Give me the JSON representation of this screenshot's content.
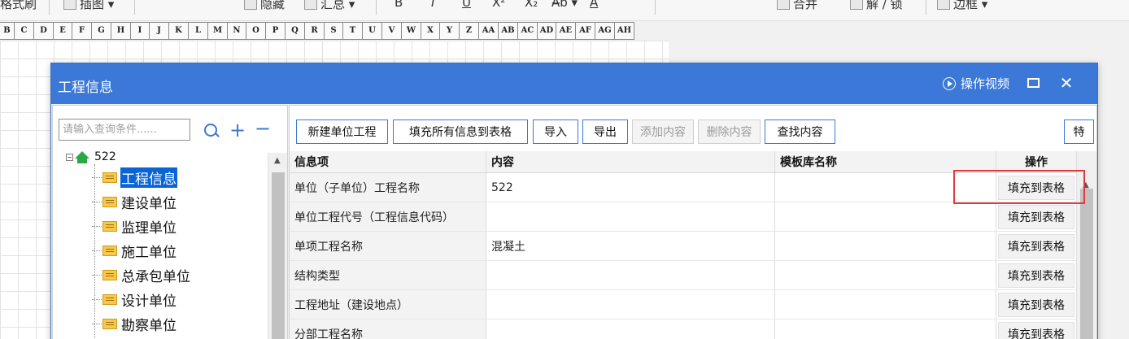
{
  "ribbon": {
    "items": [
      {
        "label": "格式刷",
        "icon": "format-painter-icon"
      },
      {
        "label": "插图 ▾",
        "icon": "picture-icon"
      },
      {
        "label": "隐藏",
        "icon": "hide-icon"
      },
      {
        "label": "汇总 ▾",
        "icon": "sum-icon"
      },
      {
        "label": "B",
        "icon": "bold-icon"
      },
      {
        "label": "I",
        "icon": "italic-icon"
      },
      {
        "label": "U",
        "icon": "underline-icon"
      },
      {
        "label": "X²",
        "icon": "superscript-icon"
      },
      {
        "label": "X₂",
        "icon": "subscript-icon"
      },
      {
        "label": "A̶b ▾",
        "icon": "strikethrough-icon"
      },
      {
        "label": "A",
        "icon": "font-color-icon"
      },
      {
        "label": "合并",
        "icon": "merge-icon"
      },
      {
        "label": "解 / 锁",
        "icon": "lock-icon"
      },
      {
        "label": "边框 ▾",
        "icon": "border-icon"
      }
    ]
  },
  "columns": [
    "B",
    "C",
    "D",
    "E",
    "F",
    "G",
    "H",
    "I",
    "J",
    "K",
    "L",
    "M",
    "N",
    "O",
    "P",
    "Q",
    "R",
    "S",
    "T",
    "U",
    "V",
    "W",
    "X",
    "Y",
    "Z",
    "AA",
    "AB",
    "AC",
    "AD",
    "AE",
    "AF",
    "AG",
    "AH"
  ],
  "dialog": {
    "title": "工程信息",
    "video_label": "操作视频",
    "search_placeholder": "请输入查询条件......",
    "tree": {
      "root": "522",
      "items": [
        "工程信息",
        "建设单位",
        "监理单位",
        "施工单位",
        "总承包单位",
        "设计单位",
        "勘察单位"
      ],
      "selected_index": 0
    },
    "toolbar": {
      "new_unit": "新建单位工程",
      "fill_all": "填充所有信息到表格",
      "import": "导入",
      "export": "导出",
      "add": "添加内容",
      "delete": "删除内容",
      "find": "查找内容",
      "special": "特"
    },
    "table": {
      "headers": [
        "信息项",
        "内容",
        "模板库名称",
        "操作"
      ],
      "rows": [
        {
          "item": "单位（子单位）工程名称",
          "content": "522",
          "template": "",
          "action": "填充到表格"
        },
        {
          "item": "单位工程代号（工程信息代码）",
          "content": "",
          "template": "",
          "action": "填充到表格"
        },
        {
          "item": "单项工程名称",
          "content": "混凝土",
          "template": "",
          "action": "填充到表格"
        },
        {
          "item": "结构类型",
          "content": "",
          "template": "",
          "action": "填充到表格"
        },
        {
          "item": "工程地址（建设地点）",
          "content": "",
          "template": "",
          "action": "填充到表格"
        },
        {
          "item": "分部工程名称",
          "content": "",
          "template": "",
          "action": "填充到表格"
        }
      ]
    }
  },
  "colors": {
    "title_bar": "#3c78d8",
    "selection": "#0a64d6",
    "highlight_box": "#e0393e",
    "home_icon": "#2aa845",
    "folder_icon": "#f7c84a"
  }
}
